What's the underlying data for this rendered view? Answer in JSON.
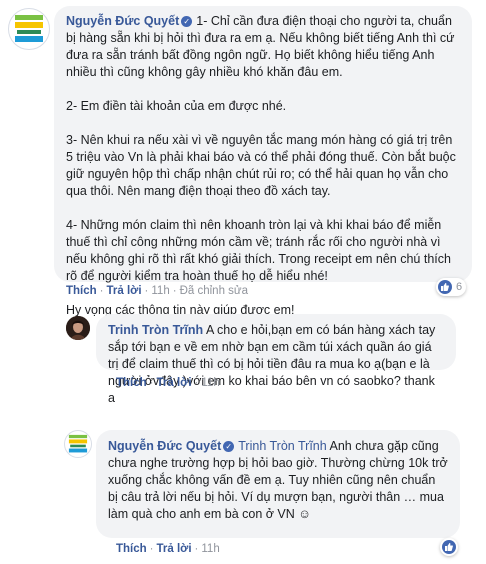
{
  "comment1": {
    "author": "Nguyễn Đức Quyết",
    "avatar": "logo-avatar",
    "paragraphs": [
      "1- Chỉ cần đưa điện thoại cho người ta, chuẩn bị hàng sẵn khi bị hỏi thì đưa ra em ạ. Nếu không biết tiếng Anh thì cứ đưa ra sẵn tránh bất đồng ngôn ngữ. Họ biết không hiểu tiếng Anh nhiều thì cũng không gây nhiều khó khăn đâu em.",
      "2- Em điền tài khoản của em được nhé.",
      "3- Nên khui ra nếu xài vì về nguyên tắc mang món hàng có giá trị trên 5 triệu vào Vn là phải khai báo và có thể phải đóng thuế. Còn bắt buộc giữ nguyên hộp thì chấp nhận chút rủi ro; có thể hải quan họ vẫn cho qua thôi. Nên mang điện thoại theo đồ xách tay.",
      "4- Những món claim thì nên khoanh tròn lại và khi khai báo để miễn thuế thì chỉ công những món cầm về; tránh rắc rối cho người nhà vì nếu không ghi rõ thì rất khó giải thích. Trong receipt em nên chú thích rõ để người kiểm tra hoàn thuế họ dễ hiểu nhé!",
      "Hy vọng các thông tin này giúp được em!"
    ],
    "actions": {
      "like": "Thích",
      "reply": "Trả lời",
      "time": "11h",
      "edited": "Đã chỉnh sửa"
    },
    "reactions": {
      "count": "6"
    }
  },
  "reply1": {
    "author": "Trinh Tròn Trĩnh",
    "text": "A cho e hỏi,bạn em có bán hàng xách tay sắp tới bạn e về em nhờ bạn em cầm túi xách quần áo giá trị để claim thuế thì có bị hỏi tiền đâu ra mua ko ạ(bạn e là người ởvđây )với em ko khai báo bên vn có saobko? thank a",
    "actions": {
      "like": "Thích",
      "reply": "Trả lời",
      "time": "11h"
    }
  },
  "reply2": {
    "author": "Nguyễn Đức Quyết",
    "mention": "Trinh Tròn Trĩnh",
    "text": "Anh chưa gặp cũng chưa nghe trường hợp bị hỏi bao giờ. Thường chừng 10k trở xuống chắc không vấn đề em ạ. Tuy nhiên cũng nên chuẩn bị câu trả lời nếu bị hỏi. Ví dụ mượn bạn, người thân … mua làm quà cho anh em bà con ở VN ☺",
    "actions": {
      "like": "Thích",
      "reply": "Trả lời",
      "time": "11h"
    },
    "reactions": {
      "count": ""
    }
  },
  "colors": {
    "link": "#385898",
    "bubble": "#f2f3f5",
    "meta": "#90949c",
    "like": "#4267b2"
  }
}
